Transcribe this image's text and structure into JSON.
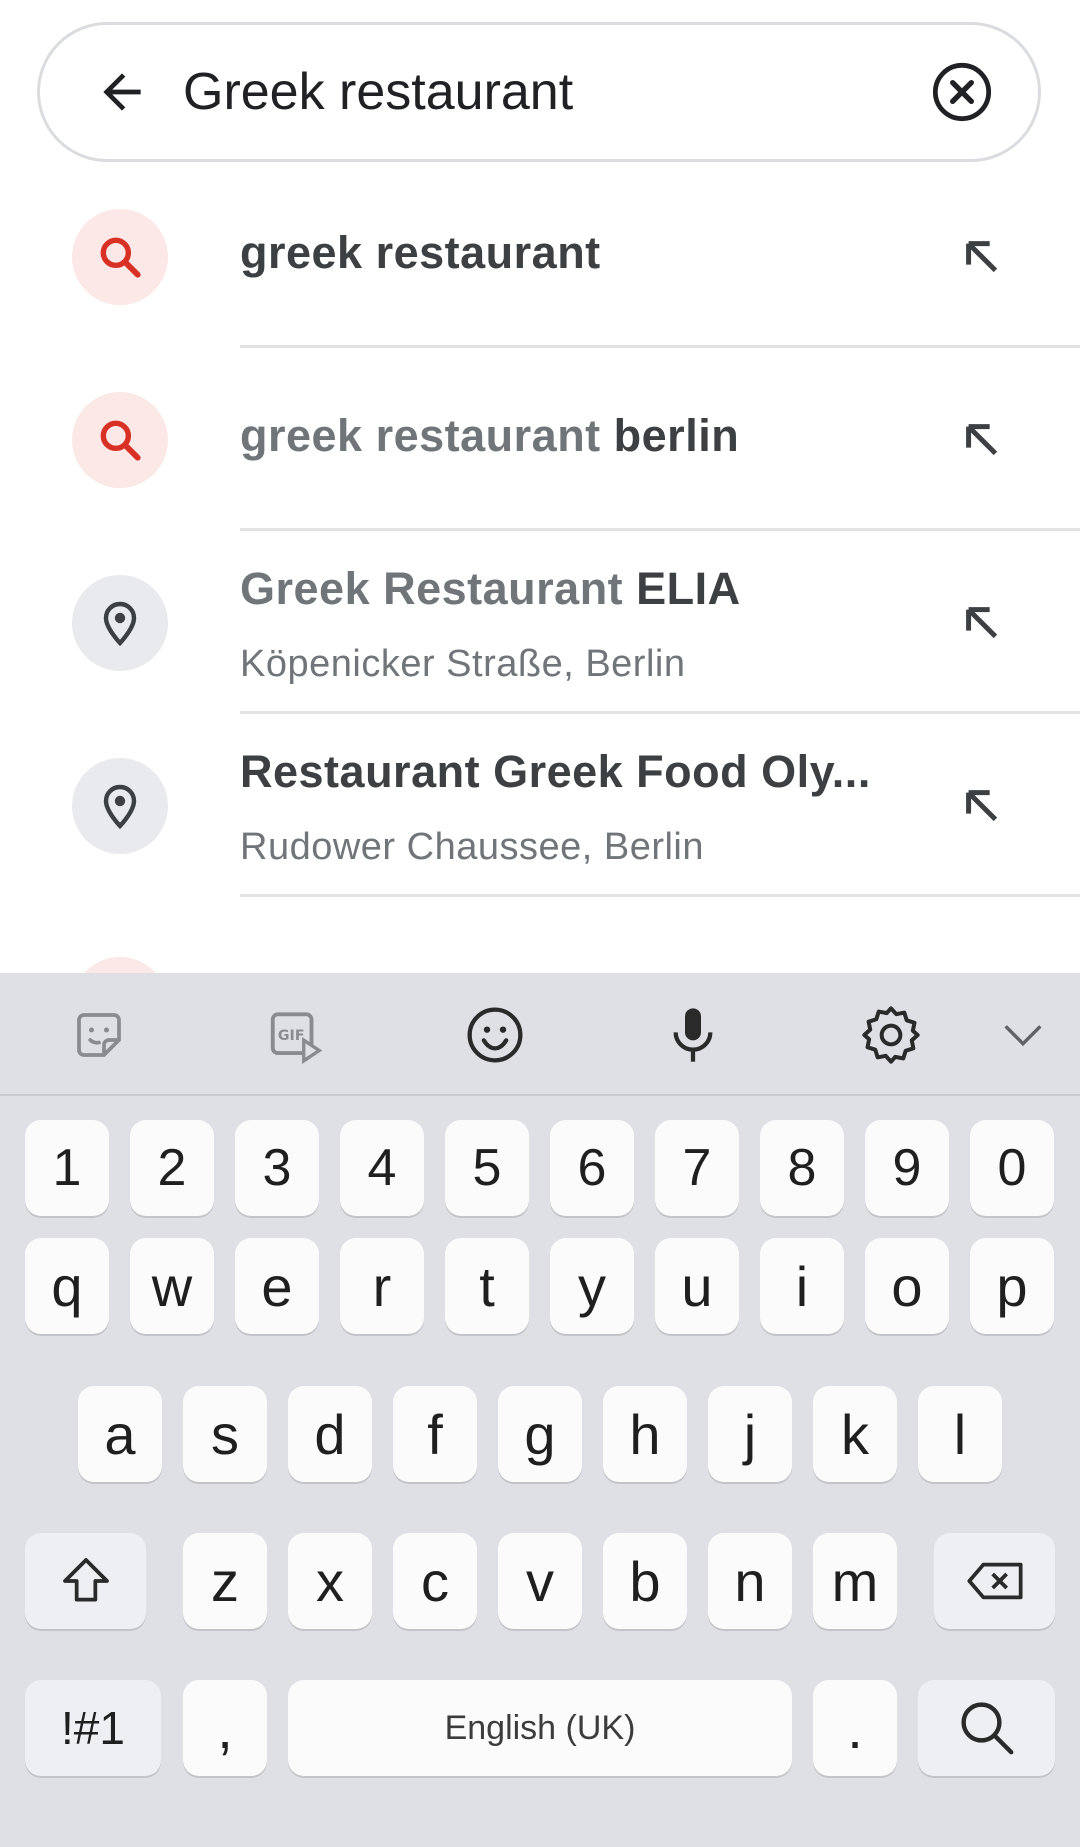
{
  "search": {
    "query": "Greek restaurant",
    "back_icon": "arrow-left-icon",
    "clear_icon": "close-circle-icon"
  },
  "suggestions": [
    {
      "type": "query",
      "icon": "search-icon",
      "title_light": "",
      "title_bold": "greek restaurant",
      "subtitle": ""
    },
    {
      "type": "query",
      "icon": "search-icon",
      "title_light": "greek restaurant ",
      "title_bold": "berlin",
      "subtitle": ""
    },
    {
      "type": "place",
      "icon": "place-pin-icon",
      "title_light": "Greek Restaurant ",
      "title_bold": "ELIA",
      "subtitle": "Köpenicker Straße, Berlin"
    },
    {
      "type": "place",
      "icon": "place-pin-icon",
      "title_light": "",
      "title_bold": "Restaurant Greek Food Oly...",
      "subtitle": "Rudower Chaussee, Berlin"
    }
  ],
  "keyboard": {
    "toolbar_icons": [
      "sticker-icon",
      "gif-icon",
      "emoji-icon",
      "microphone-icon",
      "settings-icon",
      "chevron-down-icon"
    ],
    "number_row": [
      "1",
      "2",
      "3",
      "4",
      "5",
      "6",
      "7",
      "8",
      "9",
      "0"
    ],
    "row1": [
      "q",
      "w",
      "e",
      "r",
      "t",
      "y",
      "u",
      "i",
      "o",
      "p"
    ],
    "row2": [
      "a",
      "s",
      "d",
      "f",
      "g",
      "h",
      "j",
      "k",
      "l"
    ],
    "row3": [
      "z",
      "x",
      "c",
      "v",
      "b",
      "n",
      "m"
    ],
    "symbols_label": "!#1",
    "comma_label": ",",
    "space_label": "English (UK)",
    "period_label": ".",
    "colors": {
      "search_icon_red": "#d93025",
      "search_circle_bg": "#fce8e6",
      "place_circle_bg": "#e8eaed",
      "keyboard_bg": "#dfe0e5"
    }
  }
}
